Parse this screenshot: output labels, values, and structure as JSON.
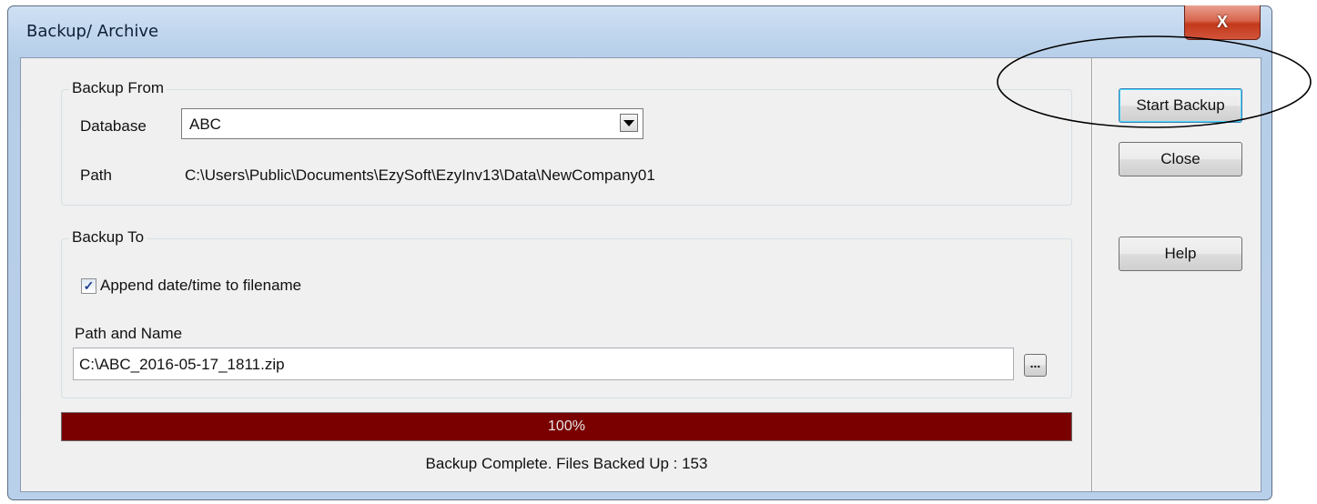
{
  "window": {
    "title": "Backup/ Archive",
    "close_glyph": "X"
  },
  "backup_from": {
    "legend": "Backup From",
    "database_label": "Database",
    "database_value": "ABC",
    "path_label": "Path",
    "path_value": "C:\\Users\\Public\\Documents\\EzySoft\\EzyInv13\\Data\\NewCompany01"
  },
  "backup_to": {
    "legend": "Backup To",
    "append_label": "Append date/time to filename",
    "append_checked": true,
    "check_glyph": "✓",
    "path_name_label": "Path and Name",
    "path_name_value": "C:\\ABC_2016-05-17_1811.zip",
    "browse_label": "..."
  },
  "progress": {
    "value_percent": 100,
    "label": "100%",
    "fill_color": "#7a0000"
  },
  "status_text": "Backup Complete. Files Backed Up : 153",
  "buttons": {
    "start_backup": "Start Backup",
    "close": "Close",
    "help": "Help"
  },
  "icons": {
    "dropdown": "chevron-down-icon",
    "close": "close-icon",
    "check": "check-icon"
  }
}
